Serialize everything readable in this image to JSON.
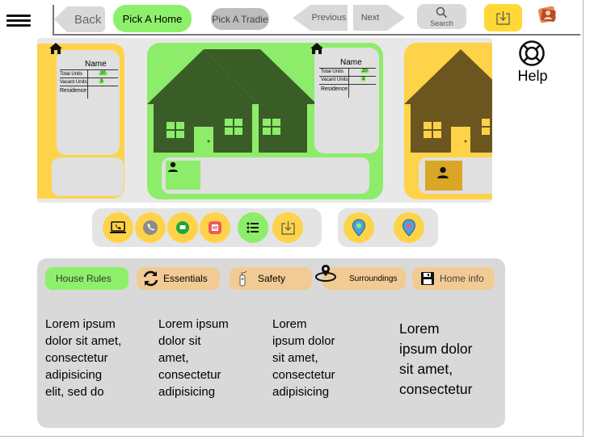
{
  "toolbar": {
    "back_label": "Back",
    "pick_home_label": "Pick A Home",
    "pick_tradie_label": "Pick A Tradie",
    "previous_label": "Previous",
    "next_label": "Next",
    "search_label": "Search",
    "help_label": "Help"
  },
  "cards": {
    "left": {
      "name_label": "Name",
      "rows": [
        "Total Units",
        "Vacant Units",
        "Residence"
      ],
      "total_units": "20",
      "vacant_units": "3"
    },
    "center": {
      "name_label": "Name",
      "rows": [
        "Total Units",
        "Vacant Units",
        "Residence"
      ],
      "total_units": "20",
      "vacant_units": "3"
    }
  },
  "tabs": {
    "house_rules": "House Rules",
    "essentials": "Essentials",
    "safety": "Safety",
    "surroundings": "Surroundings",
    "home_info": "Home info"
  },
  "content": {
    "col1": [
      "Lorem ipsum",
      "dolor sit amet,",
      "consectetur",
      "adipisicing",
      "elit, sed do"
    ],
    "col2": [
      "Lorem ipsum",
      "dolor sit",
      "amet,",
      "consectetur",
      "adipisicing"
    ],
    "col3": [
      "Lorem",
      "ipsum dolor",
      "sit amet,",
      "consectetur",
      "adipisicing"
    ],
    "col4": [
      "Lorem",
      "ipsum dolor",
      "sit amet,",
      "consectetur"
    ]
  },
  "colors": {
    "accent_green": "#8df06a",
    "accent_yellow": "#ffd349",
    "tab_tan": "#f2cb94",
    "house_dark_green": "#3a5d28",
    "house_olive": "#6b5620"
  },
  "icons": [
    "menu-icon",
    "back-arrow-icon",
    "previous-arrow-icon",
    "next-arrow-icon",
    "search-icon",
    "download-icon",
    "profile-icon",
    "lifebuoy-icon",
    "house-icon",
    "person-icon",
    "laptop-icon",
    "phone-icon",
    "chat-icon",
    "calendar-icon",
    "list-icon",
    "location-pin-icon",
    "refresh-icon",
    "extinguisher-icon",
    "map-pin-icon",
    "save-icon"
  ]
}
